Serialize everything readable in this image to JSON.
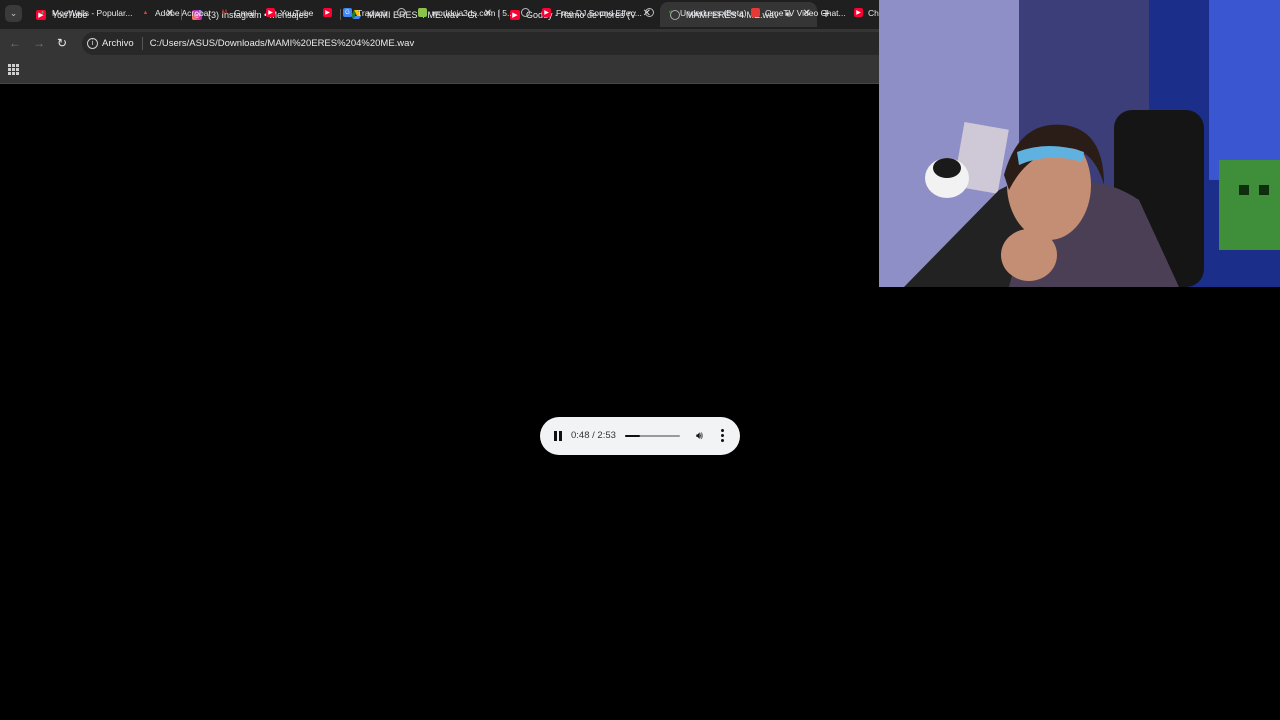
{
  "browser": {
    "tabs": [
      {
        "title": "YouTube",
        "favicon": "youtube-icon",
        "active": false
      },
      {
        "title": "(3) Instagram • Mensajes",
        "favicon": "instagram-icon",
        "active": false
      },
      {
        "title": "MAMI ERES 4 ME.wav - Google",
        "favicon": "google-drive-icon",
        "active": false
      },
      {
        "title": "Goddy - Ramo de Flores (Video",
        "favicon": "youtube-icon",
        "active": false
      },
      {
        "title": "MAMI ERES 4 ME.wav",
        "favicon": "globe-icon",
        "active": true,
        "audio_playing": true
      }
    ],
    "omnibox": {
      "chip_label": "Archivo",
      "url": "C:/Users/ASUS/Downloads/MAMI%20ERES%204%20ME.wav"
    },
    "bookmarks": [
      {
        "label": "MoeWalls - Popular...",
        "icon": "moewalls-icon"
      },
      {
        "label": "Adobe Acrobat",
        "icon": "acrobat-icon"
      },
      {
        "label": "Gmail",
        "icon": "gmail-icon"
      },
      {
        "label": "YouTube",
        "icon": "youtube-icon"
      },
      {
        "label": "",
        "icon": "youtube-icon"
      },
      {
        "label": "Traducir",
        "icon": "translate-icon"
      },
      {
        "label": "",
        "icon": "globe-icon"
      },
      {
        "label": "worldcia3ds.com | 5...",
        "icon": "worldcia-icon"
      },
      {
        "label": "",
        "icon": "globe-icon"
      },
      {
        "label": "Free DJ Sound Effec...",
        "icon": "youtube-icon"
      },
      {
        "label": "",
        "icon": "globe-icon"
      },
      {
        "label": "UnderLess (Beta)",
        "icon": "underless-icon"
      },
      {
        "label": "OmeTV Video Chat...",
        "icon": "ometv-icon"
      },
      {
        "label": "Cha",
        "icon": "youtube-icon"
      }
    ]
  },
  "player": {
    "current_time": "0:48",
    "duration": "2:53",
    "time_display": "0:48 / 2:53",
    "progress_fraction": 0.277
  },
  "colors": {
    "page_background": "#000000",
    "tabbar": "#1f1f1f",
    "toolbar": "#353535",
    "player_background": "#f1f3f4",
    "youtube_red": "#ff0033"
  }
}
